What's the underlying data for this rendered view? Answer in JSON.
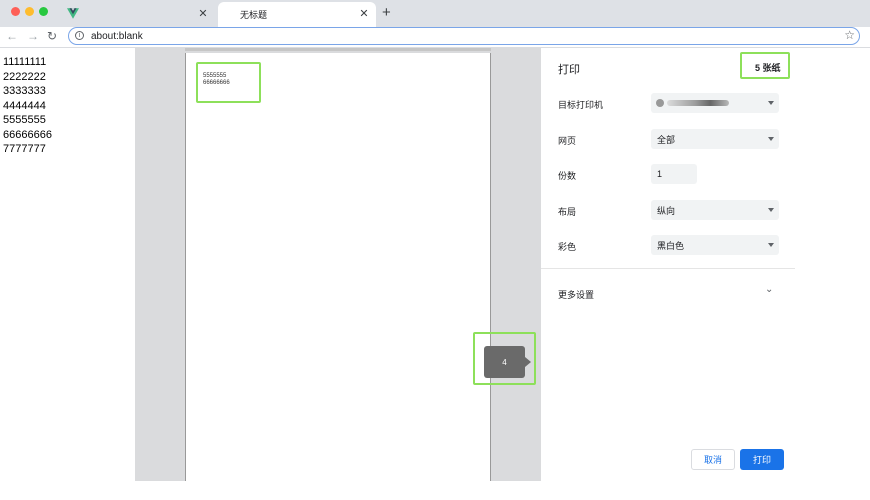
{
  "browser": {
    "active_tab_title": "无标题",
    "url": "about:blank",
    "traffic_light_colors": [
      "#fe5f57",
      "#febc2e",
      "#28c840"
    ],
    "icons": {
      "close_tab": "close-icon",
      "new_tab": "plus-icon",
      "back": "arrow-left-icon",
      "forward": "arrow-right-icon",
      "reload": "reload-icon",
      "info": "info-icon",
      "bookmark": "star-icon"
    }
  },
  "page": {
    "lines": [
      "11111111",
      "2222222",
      "3333333",
      "4444444",
      "5555555",
      "66666666",
      "7777777"
    ]
  },
  "preview": {
    "sheet_lines": [
      "5555555",
      "66666666"
    ],
    "page_number": "4"
  },
  "print_dialog": {
    "title": "打印",
    "sheet_count": "5 张纸",
    "rows": {
      "destination": {
        "label": "目标打印机"
      },
      "pages": {
        "label": "网页",
        "value": "全部"
      },
      "copies": {
        "label": "份数",
        "value": "1"
      },
      "layout": {
        "label": "布局",
        "value": "纵向"
      },
      "color": {
        "label": "彩色",
        "value": "黑白色"
      }
    },
    "more_settings": "更多设置",
    "cancel": "取消",
    "print": "打印"
  },
  "colors": {
    "highlight": "#8de05a",
    "primary_button": "#1a73e8"
  }
}
